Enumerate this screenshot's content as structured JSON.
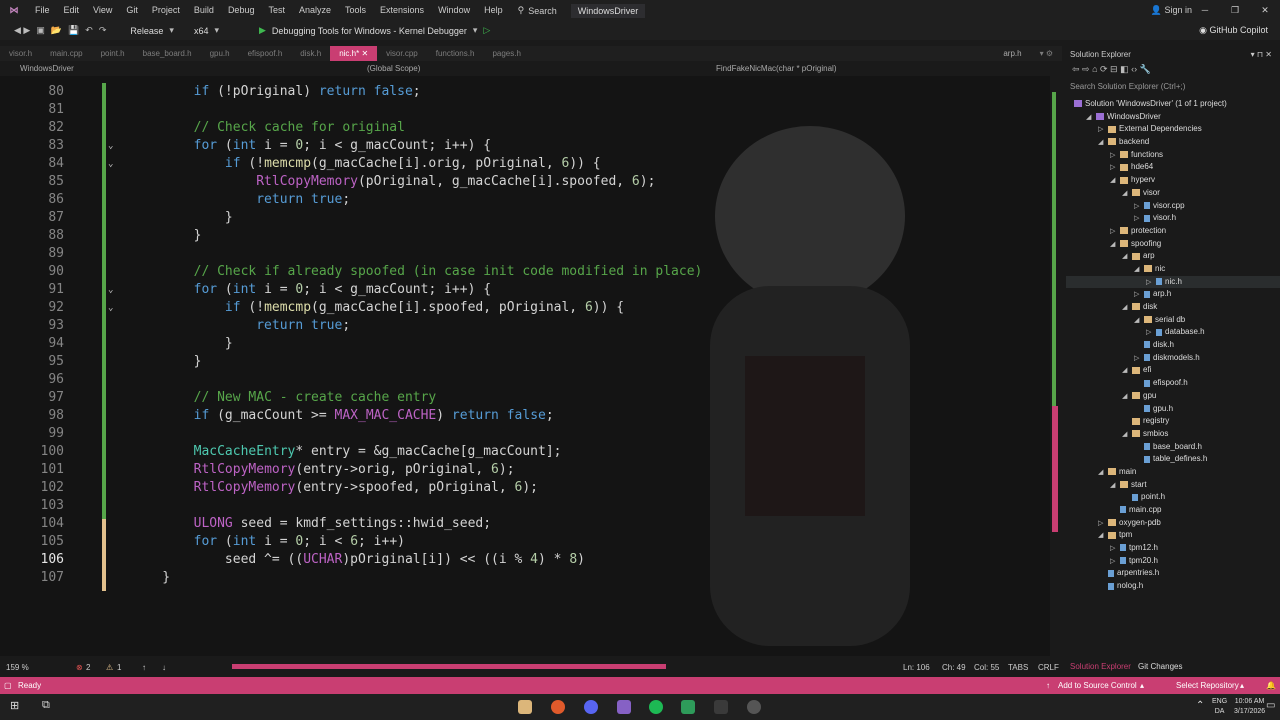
{
  "menu": {
    "items": [
      "File",
      "Edit",
      "View",
      "Git",
      "Project",
      "Build",
      "Debug",
      "Test",
      "Analyze",
      "Tools",
      "Extensions",
      "Window",
      "Help"
    ],
    "search": "Search",
    "solution_name": "WindowsDriver",
    "sign_in": "Sign in"
  },
  "toolbar": {
    "configuration": "Release",
    "platform": "x64",
    "run_target": "Debugging Tools for Windows - Kernel Debugger",
    "copilot": "GitHub Copilot"
  },
  "tabs": [
    {
      "label": "visor.h",
      "active": false
    },
    {
      "label": "main.cpp",
      "active": false
    },
    {
      "label": "point.h",
      "active": false
    },
    {
      "label": "base_board.h",
      "active": false
    },
    {
      "label": "gpu.h",
      "active": false
    },
    {
      "label": "efispoof.h",
      "active": false
    },
    {
      "label": "disk.h",
      "active": false
    },
    {
      "label": "nic.h*",
      "active": true
    },
    {
      "label": "visor.cpp",
      "active": false
    },
    {
      "label": "functions.h",
      "active": false
    },
    {
      "label": "pages.h",
      "active": false
    }
  ],
  "pinned_tab": "arp.h",
  "navbar": {
    "project": "WindowsDriver",
    "scope": "(Global Scope)",
    "function": "FindFakeNicMac(char * pOriginal)"
  },
  "editor": {
    "current_line": 106,
    "lines": [
      {
        "n": 80,
        "fold": false,
        "tokens": [
          [
            "t",
            "        "
          ],
          [
            "kw",
            "if"
          ],
          [
            "t",
            " (!pOriginal) "
          ],
          [
            "kw",
            "return"
          ],
          [
            "t",
            " "
          ],
          [
            "kw",
            "false"
          ],
          [
            "t",
            ";"
          ]
        ]
      },
      {
        "n": 81,
        "fold": false,
        "tokens": []
      },
      {
        "n": 82,
        "fold": false,
        "tokens": [
          [
            "t",
            "        "
          ],
          [
            "cm",
            "// Check cache for original"
          ]
        ]
      },
      {
        "n": 83,
        "fold": true,
        "tokens": [
          [
            "t",
            "        "
          ],
          [
            "kw",
            "for"
          ],
          [
            "t",
            " ("
          ],
          [
            "kw",
            "int"
          ],
          [
            "t",
            " i = "
          ],
          [
            "num",
            "0"
          ],
          [
            "t",
            "; i < g_macCount; i++) {"
          ]
        ]
      },
      {
        "n": 84,
        "fold": true,
        "tokens": [
          [
            "t",
            "            "
          ],
          [
            "kw",
            "if"
          ],
          [
            "t",
            " (!"
          ],
          [
            "fn",
            "memcmp"
          ],
          [
            "t",
            "(g_macCache[i].orig, pOriginal, "
          ],
          [
            "num",
            "6"
          ],
          [
            "t",
            ")) {"
          ]
        ]
      },
      {
        "n": 85,
        "fold": false,
        "tokens": [
          [
            "t",
            "                "
          ],
          [
            "mc",
            "RtlCopyMemory"
          ],
          [
            "t",
            "(pOriginal, g_macCache[i].spoofed, "
          ],
          [
            "num",
            "6"
          ],
          [
            "t",
            ");"
          ]
        ]
      },
      {
        "n": 86,
        "fold": false,
        "tokens": [
          [
            "t",
            "                "
          ],
          [
            "kw",
            "return"
          ],
          [
            "t",
            " "
          ],
          [
            "kw",
            "true"
          ],
          [
            "t",
            ";"
          ]
        ]
      },
      {
        "n": 87,
        "fold": false,
        "tokens": [
          [
            "t",
            "            }"
          ]
        ]
      },
      {
        "n": 88,
        "fold": false,
        "tokens": [
          [
            "t",
            "        }"
          ]
        ]
      },
      {
        "n": 89,
        "fold": false,
        "tokens": []
      },
      {
        "n": 90,
        "fold": false,
        "tokens": [
          [
            "t",
            "        "
          ],
          [
            "cm",
            "// Check if already spoofed (in case init code modified in place)"
          ]
        ]
      },
      {
        "n": 91,
        "fold": true,
        "tokens": [
          [
            "t",
            "        "
          ],
          [
            "kw",
            "for"
          ],
          [
            "t",
            " ("
          ],
          [
            "kw",
            "int"
          ],
          [
            "t",
            " i = "
          ],
          [
            "num",
            "0"
          ],
          [
            "t",
            "; i < g_macCount; i++) {"
          ]
        ]
      },
      {
        "n": 92,
        "fold": true,
        "tokens": [
          [
            "t",
            "            "
          ],
          [
            "kw",
            "if"
          ],
          [
            "t",
            " (!"
          ],
          [
            "fn",
            "memcmp"
          ],
          [
            "t",
            "(g_macCache[i].spoofed, pOriginal, "
          ],
          [
            "num",
            "6"
          ],
          [
            "t",
            ")) {"
          ]
        ]
      },
      {
        "n": 93,
        "fold": false,
        "tokens": [
          [
            "t",
            "                "
          ],
          [
            "kw",
            "return"
          ],
          [
            "t",
            " "
          ],
          [
            "kw",
            "true"
          ],
          [
            "t",
            ";"
          ]
        ]
      },
      {
        "n": 94,
        "fold": false,
        "tokens": [
          [
            "t",
            "            }"
          ]
        ]
      },
      {
        "n": 95,
        "fold": false,
        "tokens": [
          [
            "t",
            "        }"
          ]
        ]
      },
      {
        "n": 96,
        "fold": false,
        "tokens": []
      },
      {
        "n": 97,
        "fold": false,
        "tokens": [
          [
            "t",
            "        "
          ],
          [
            "cm",
            "// New MAC - create cache entry"
          ]
        ]
      },
      {
        "n": 98,
        "fold": false,
        "tokens": [
          [
            "t",
            "        "
          ],
          [
            "kw",
            "if"
          ],
          [
            "t",
            " (g_macCount >= "
          ],
          [
            "mc",
            "MAX_MAC_CACHE"
          ],
          [
            "t",
            ") "
          ],
          [
            "kw",
            "return"
          ],
          [
            "t",
            " "
          ],
          [
            "kw",
            "false"
          ],
          [
            "t",
            ";"
          ]
        ]
      },
      {
        "n": 99,
        "fold": false,
        "tokens": []
      },
      {
        "n": 100,
        "fold": false,
        "tokens": [
          [
            "t",
            "        "
          ],
          [
            "ty",
            "MacCacheEntry"
          ],
          [
            "t",
            "* entry = &g_macCache[g_macCount];"
          ]
        ]
      },
      {
        "n": 101,
        "fold": false,
        "tokens": [
          [
            "t",
            "        "
          ],
          [
            "mc",
            "RtlCopyMemory"
          ],
          [
            "t",
            "(entry->orig, pOriginal, "
          ],
          [
            "num",
            "6"
          ],
          [
            "t",
            ");"
          ]
        ]
      },
      {
        "n": 102,
        "fold": false,
        "tokens": [
          [
            "t",
            "        "
          ],
          [
            "mc",
            "RtlCopyMemory"
          ],
          [
            "t",
            "(entry->spoofed, pOriginal, "
          ],
          [
            "num",
            "6"
          ],
          [
            "t",
            ");"
          ]
        ]
      },
      {
        "n": 103,
        "fold": false,
        "tokens": []
      },
      {
        "n": 104,
        "fold": false,
        "tokens": [
          [
            "t",
            "        "
          ],
          [
            "mc",
            "ULONG"
          ],
          [
            "t",
            " seed = kmdf_settings::hwid_seed;"
          ]
        ]
      },
      {
        "n": 105,
        "fold": false,
        "tokens": [
          [
            "t",
            "        "
          ],
          [
            "kw",
            "for"
          ],
          [
            "t",
            " ("
          ],
          [
            "kw",
            "int"
          ],
          [
            "t",
            " i = "
          ],
          [
            "num",
            "0"
          ],
          [
            "t",
            "; i < "
          ],
          [
            "num",
            "6"
          ],
          [
            "t",
            "; i++)"
          ]
        ]
      },
      {
        "n": 106,
        "fold": false,
        "tokens": [
          [
            "t",
            "            seed ^= (("
          ],
          [
            "mc",
            "UCHAR"
          ],
          [
            "t",
            ")pOriginal[i]) << ((i % "
          ],
          [
            "num",
            "4"
          ],
          [
            "t",
            ") * "
          ],
          [
            "num",
            "8"
          ],
          [
            "t",
            ")"
          ]
        ]
      },
      {
        "n": 107,
        "fold": false,
        "tokens": [
          [
            "t",
            "    }"
          ]
        ]
      }
    ]
  },
  "editor_status": {
    "zoom": "159 %",
    "errors": "2",
    "warnings": "1",
    "line": "Ln: 106",
    "char": "Ch: 49",
    "col": "Col: 55",
    "tabs": "TABS",
    "eol": "CRLF"
  },
  "solution_explorer": {
    "title": "Solution Explorer",
    "search_placeholder": "Search Solution Explorer (Ctrl+;)",
    "solution_label": "Solution 'WindowsDriver' (1 of 1 project)",
    "tree": [
      {
        "label": "WindowsDriver",
        "depth": 1,
        "kind": "proj",
        "arrow": "open"
      },
      {
        "label": "External Dependencies",
        "depth": 2,
        "kind": "folder",
        "arrow": "closed"
      },
      {
        "label": "backend",
        "depth": 2,
        "kind": "folder",
        "arrow": "open"
      },
      {
        "label": "functions",
        "depth": 3,
        "kind": "folder",
        "arrow": "closed"
      },
      {
        "label": "hde64",
        "depth": 3,
        "kind": "folder",
        "arrow": "closed"
      },
      {
        "label": "hyperv",
        "depth": 3,
        "kind": "folder",
        "arrow": "open"
      },
      {
        "label": "visor",
        "depth": 4,
        "kind": "folder",
        "arrow": "open"
      },
      {
        "label": "visor.cpp",
        "depth": 5,
        "kind": "file",
        "arrow": "closed"
      },
      {
        "label": "visor.h",
        "depth": 5,
        "kind": "file",
        "arrow": "closed"
      },
      {
        "label": "protection",
        "depth": 3,
        "kind": "folder",
        "arrow": "closed"
      },
      {
        "label": "spoofing",
        "depth": 3,
        "kind": "folder",
        "arrow": "open"
      },
      {
        "label": "arp",
        "depth": 4,
        "kind": "folder",
        "arrow": "open"
      },
      {
        "label": "nic",
        "depth": 5,
        "kind": "folder",
        "arrow": "open"
      },
      {
        "label": "nic.h",
        "depth": 6,
        "kind": "file",
        "arrow": "closed",
        "selected": true
      },
      {
        "label": "arp.h",
        "depth": 5,
        "kind": "file",
        "arrow": "closed"
      },
      {
        "label": "disk",
        "depth": 4,
        "kind": "folder",
        "arrow": "open"
      },
      {
        "label": "serial db",
        "depth": 5,
        "kind": "folder",
        "arrow": "open"
      },
      {
        "label": "database.h",
        "depth": 6,
        "kind": "file",
        "arrow": "closed"
      },
      {
        "label": "disk.h",
        "depth": 5,
        "kind": "file",
        "arrow": "none"
      },
      {
        "label": "diskmodels.h",
        "depth": 5,
        "kind": "file",
        "arrow": "closed"
      },
      {
        "label": "efi",
        "depth": 4,
        "kind": "folder",
        "arrow": "open"
      },
      {
        "label": "efispoof.h",
        "depth": 5,
        "kind": "file",
        "arrow": "none"
      },
      {
        "label": "gpu",
        "depth": 4,
        "kind": "folder",
        "arrow": "open"
      },
      {
        "label": "gpu.h",
        "depth": 5,
        "kind": "file",
        "arrow": "none"
      },
      {
        "label": "registry",
        "depth": 4,
        "kind": "folder",
        "arrow": "none"
      },
      {
        "label": "smbios",
        "depth": 4,
        "kind": "folder",
        "arrow": "open"
      },
      {
        "label": "base_board.h",
        "depth": 5,
        "kind": "file",
        "arrow": "none"
      },
      {
        "label": "table_defines.h",
        "depth": 5,
        "kind": "file",
        "arrow": "none"
      },
      {
        "label": "main",
        "depth": 2,
        "kind": "folder",
        "arrow": "open"
      },
      {
        "label": "start",
        "depth": 3,
        "kind": "folder",
        "arrow": "open"
      },
      {
        "label": "point.h",
        "depth": 4,
        "kind": "file",
        "arrow": "none"
      },
      {
        "label": "main.cpp",
        "depth": 3,
        "kind": "file",
        "arrow": "none"
      },
      {
        "label": "oxygen-pdb",
        "depth": 2,
        "kind": "folder",
        "arrow": "closed"
      },
      {
        "label": "tpm",
        "depth": 2,
        "kind": "folder",
        "arrow": "open"
      },
      {
        "label": "tpm12.h",
        "depth": 3,
        "kind": "file",
        "arrow": "closed"
      },
      {
        "label": "tpm20.h",
        "depth": 3,
        "kind": "file",
        "arrow": "closed"
      },
      {
        "label": "arpentries.h",
        "depth": 2,
        "kind": "file",
        "arrow": "none"
      },
      {
        "label": "nolog.h",
        "depth": 2,
        "kind": "file",
        "arrow": "none"
      }
    ],
    "footer_tabs": [
      "Solution Explorer",
      "Git Changes"
    ]
  },
  "statusbar": {
    "state": "Ready",
    "add_source": "Add to Source Control",
    "select_repo": "Select Repository"
  },
  "taskbar": {
    "lang": "ENG",
    "region": "DA",
    "time": "10:06 AM",
    "date": "3/17/2026"
  },
  "colors": {
    "accent": "#c93e72",
    "comment": "#57a64a",
    "keyword": "#569cd6"
  }
}
